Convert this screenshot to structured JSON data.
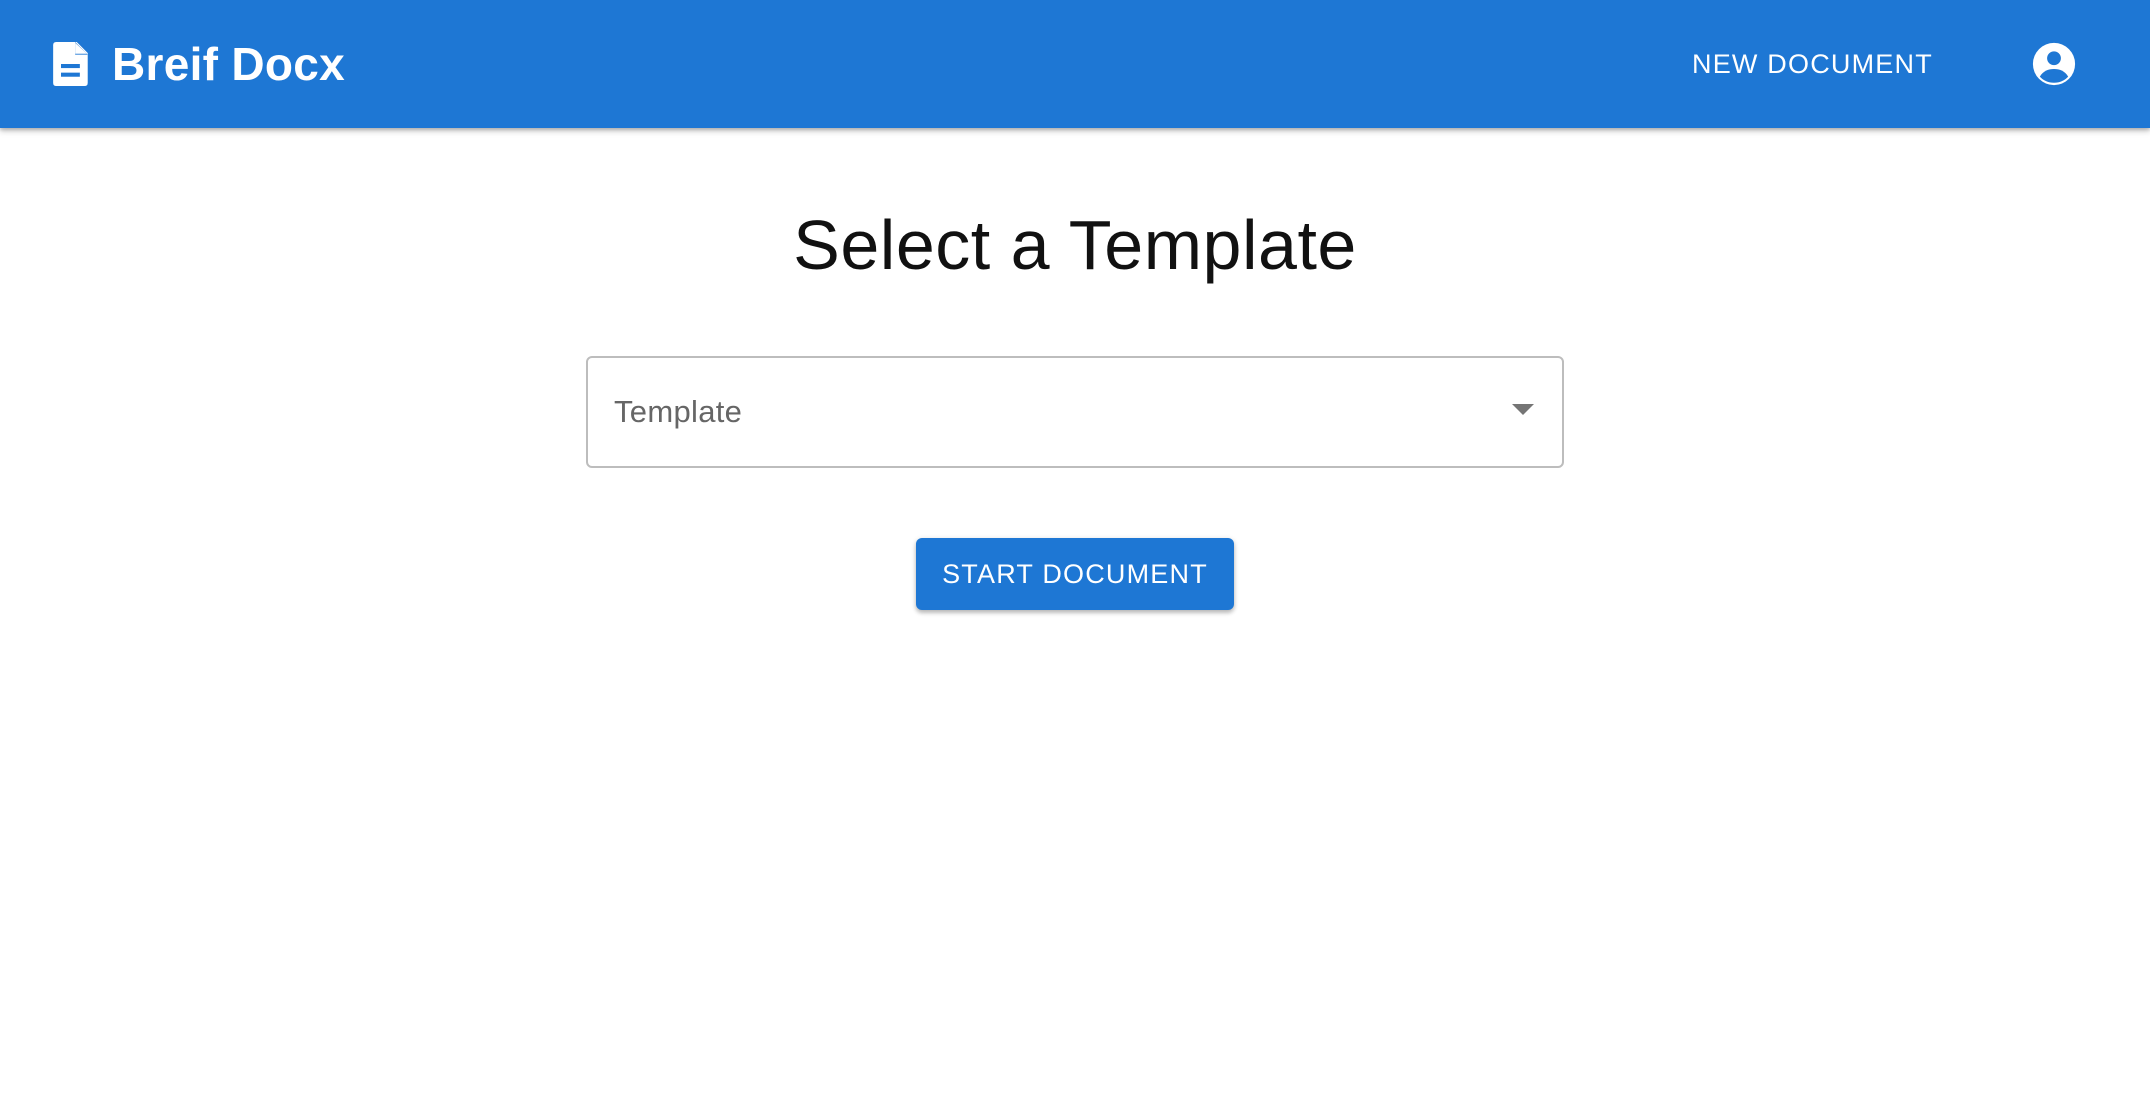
{
  "appbar": {
    "brand_icon": "document-icon",
    "title": "Breif Docx",
    "new_document_label": "NEW DOCUMENT",
    "account_icon": "account-circle-icon",
    "background_color": "#1e77d4"
  },
  "main": {
    "heading": "Select a Template",
    "template_select": {
      "label": "Template",
      "selected_value": "",
      "arrow_icon": "dropdown-arrow-icon"
    },
    "start_button_label": "START DOCUMENT"
  },
  "colors": {
    "primary": "#1e77d4",
    "text_on_primary": "#ffffff",
    "heading_text": "#111111",
    "field_label": "#666666",
    "field_border": "#bdbdbd"
  }
}
